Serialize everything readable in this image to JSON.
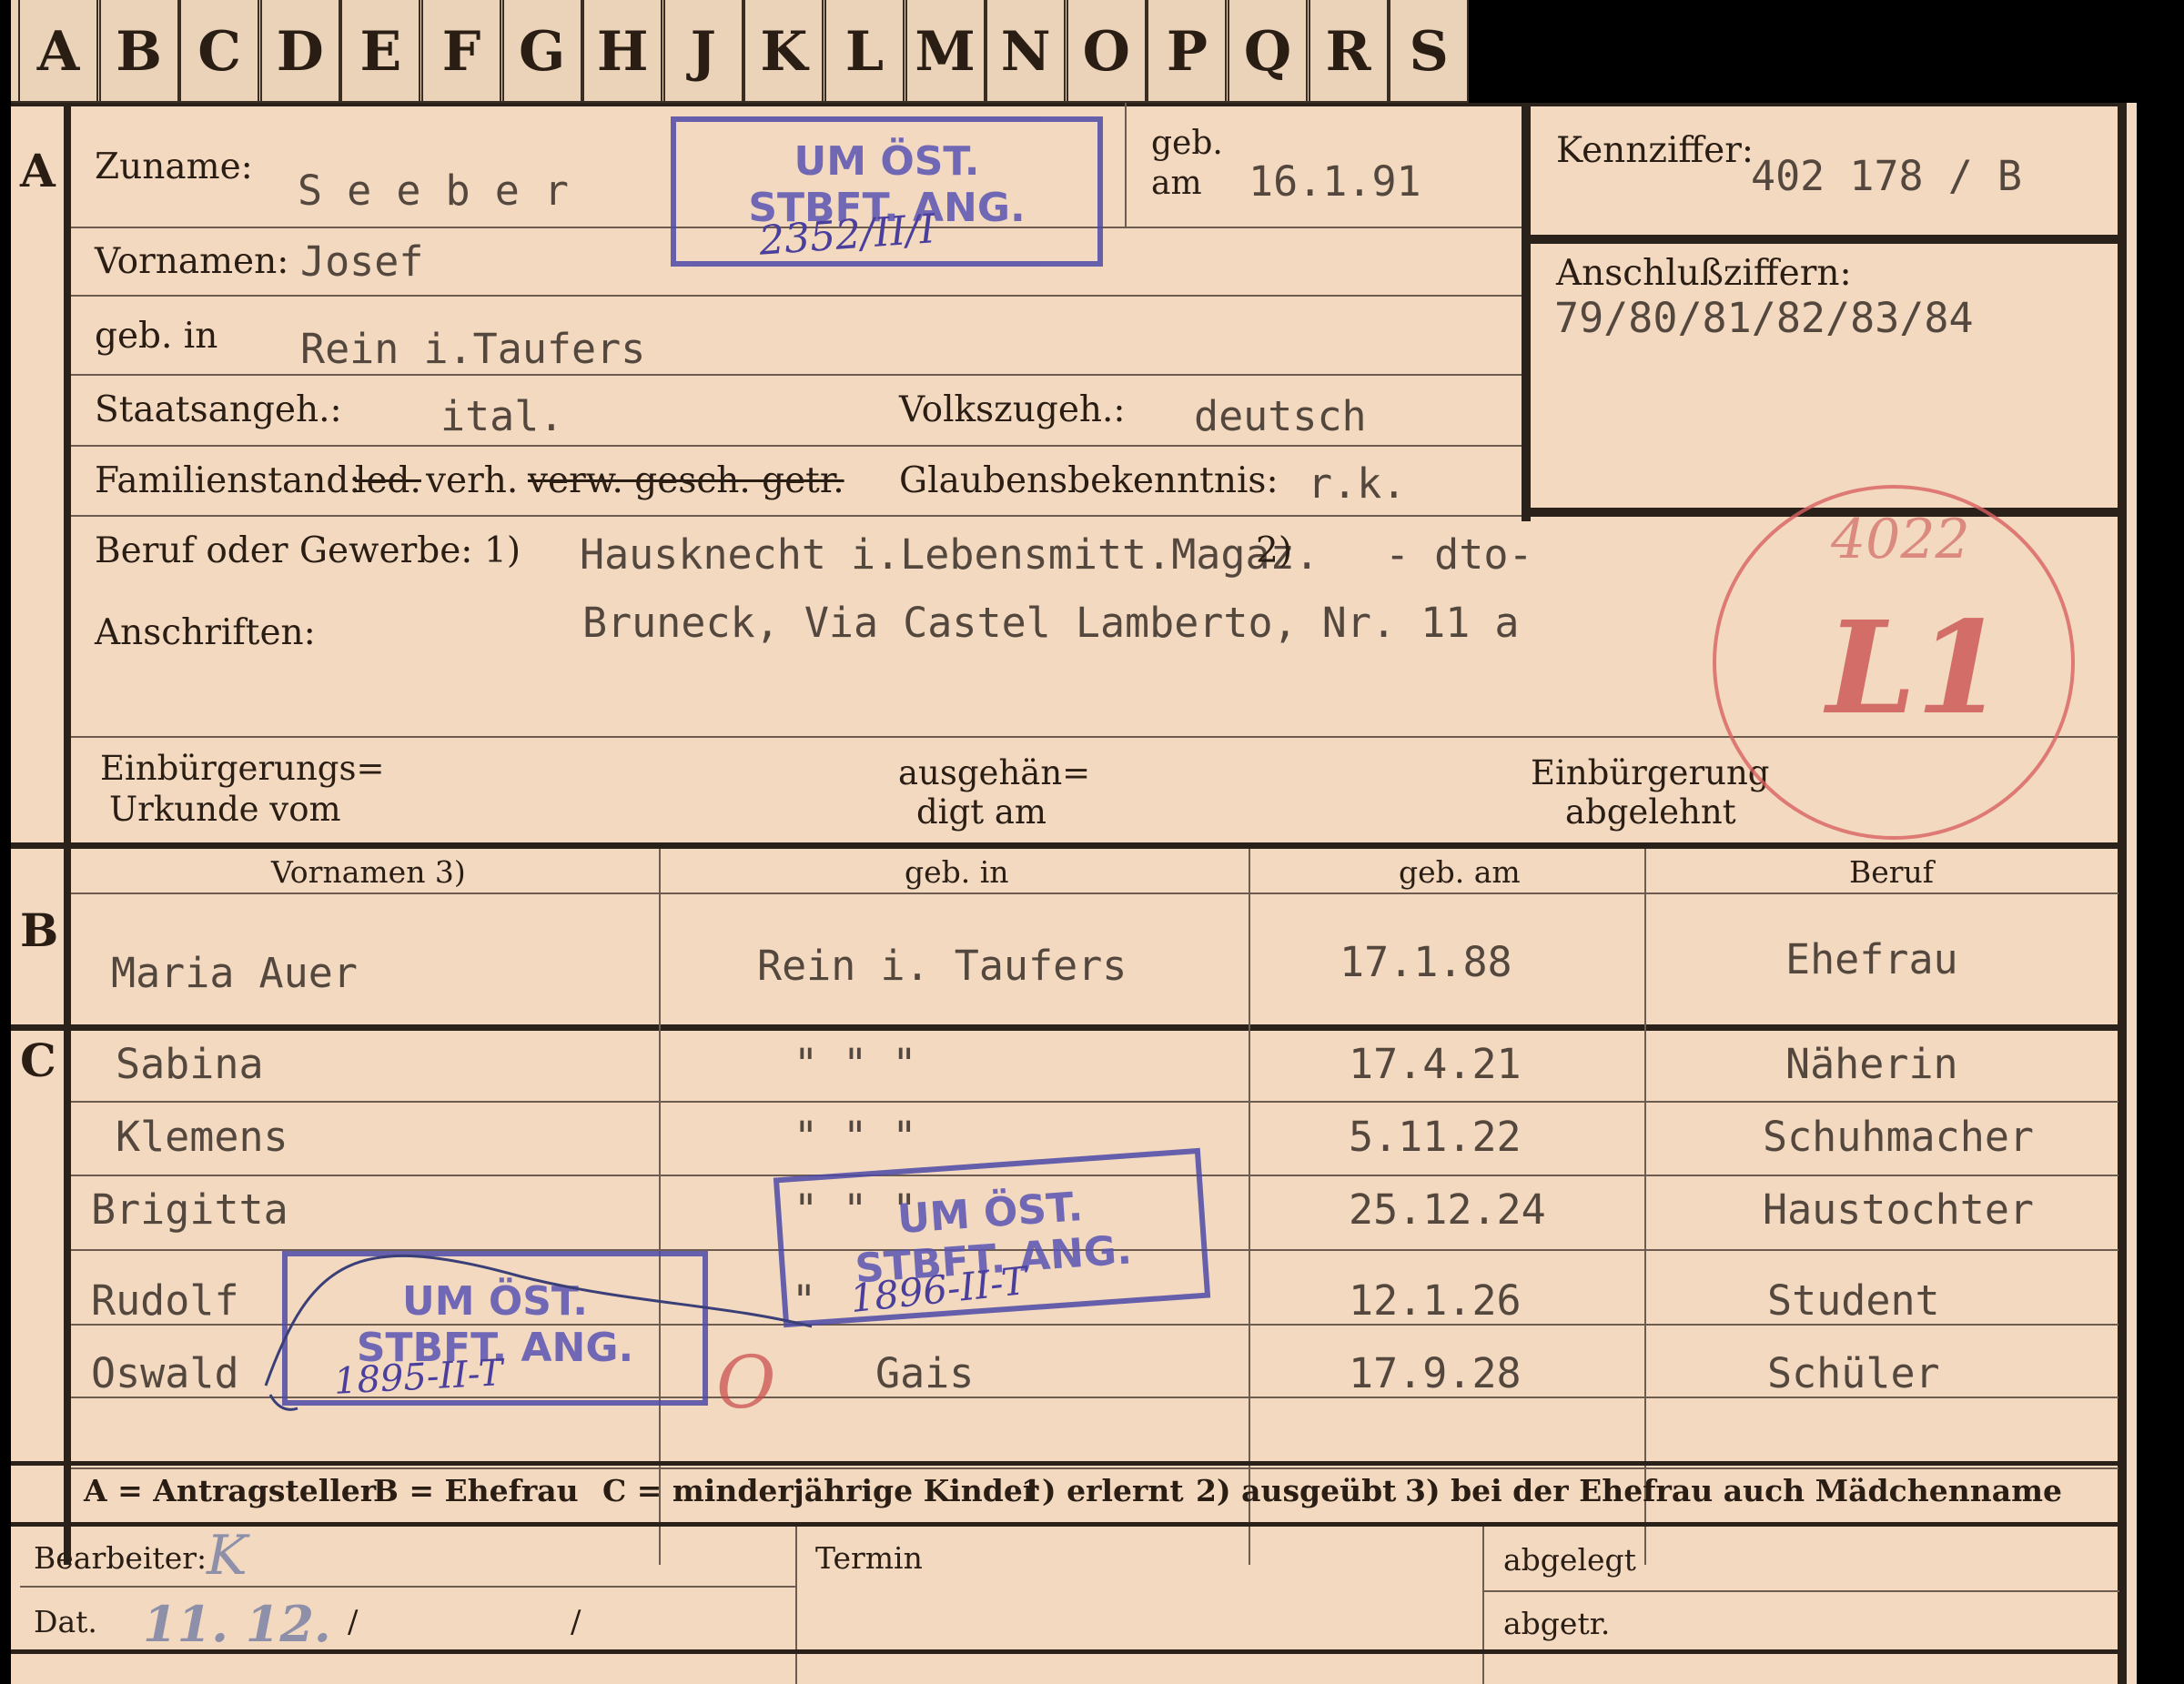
{
  "tabs": [
    "A",
    "B",
    "C",
    "D",
    "E",
    "F",
    "G",
    "H",
    "J",
    "K",
    "L",
    "M",
    "N",
    "O",
    "P",
    "Q",
    "R",
    "S"
  ],
  "sections": {
    "a": "A",
    "b": "B",
    "c": "C"
  },
  "applicant": {
    "surname_label": "Zuname:",
    "surname": "S e e b e r",
    "born_label_1": "geb.",
    "born_label_2": "am",
    "born_date": "16.1.91",
    "first_names_label": "Vornamen:",
    "first_names": "Josef",
    "birthplace_label": "geb. in",
    "birthplace": "Rein i.Taufers",
    "citizenship_label": "Staatsangeh.:",
    "citizenship": "ital.",
    "ethnicity_label": "Volkszugeh.:",
    "ethnicity": "deutsch",
    "marital_label": "Familienstand:",
    "marital_led": "led.",
    "marital_verh": "verh.",
    "marital_struck": "verw. gesch. getr.",
    "religion_label": "Glaubensbekenntnis:",
    "religion": "r.k.",
    "occupation_label": "Beruf oder Gewerbe:",
    "occupation_sup1": "1)",
    "occupation": "Hausknecht i.Lebensmitt.Magaz.",
    "occupation_sup2": "2)",
    "occupation_2": "- dto-",
    "address_label": "Anschriften:",
    "address": "Bruneck, Via Castel Lamberto, Nr. 11 a",
    "naturalization_label_1": "Einbürgerungs=",
    "naturalization_label_2": "Urkunde vom",
    "handed_label_1": "ausgehän=",
    "handed_label_2": "digt am",
    "rejected_label_1": "Einbürgerung",
    "rejected_label_2": "abgelehnt"
  },
  "reference": {
    "number_label": "Kennziffer:",
    "number": "402 178 / B",
    "connection_label": "Anschlußziffern:",
    "connection_numbers": "79/80/81/82/83/84"
  },
  "table": {
    "headers": [
      "Vornamen 3)",
      "geb. in",
      "geb. am",
      "Beruf"
    ],
    "spouse": {
      "name": "Maria   Auer",
      "birthplace": "Rein i. Taufers",
      "birth_date": "17.1.88",
      "occupation": "Ehefrau"
    },
    "children": [
      {
        "name": "Sabina",
        "birthplace": "\"    \"    \"",
        "birth_date": "17.4.21",
        "occupation": "Näherin"
      },
      {
        "name": "Klemens",
        "birthplace": "\"    \"    \"",
        "birth_date": "5.11.22",
        "occupation": "Schuhmacher"
      },
      {
        "name": "Brigitta",
        "birthplace": "\"    \"    \"",
        "birth_date": "25.12.24",
        "occupation": "Haustochter"
      },
      {
        "name": "Rudolf",
        "birthplace": "\"",
        "birth_date": "12.1.26",
        "occupation": "Student"
      },
      {
        "name": "Oswald",
        "birthplace": "Gais",
        "birth_date": "17.9.28",
        "occupation": "Schüler"
      }
    ]
  },
  "stamps": {
    "top": {
      "line1": "UM ÖST.",
      "line2": "STBFT. ANG.",
      "handwritten": "2352/II/I"
    },
    "middle": {
      "line1": "UM ÖST.",
      "line2": "STBFT. ANG.",
      "handwritten": "1896-II-T"
    },
    "bottom": {
      "line1": "UM ÖST.",
      "line2": "STBFT. ANG.",
      "handwritten": "1895-II-T"
    },
    "red_circle_number": "4022",
    "red_circle_mark": "L1",
    "red_mark_small": "O"
  },
  "legend": {
    "a": "A = Antragsteller",
    "b": "B = Ehefrau",
    "c": "C = minderjährige Kinder",
    "n1": "1) erlernt",
    "n2": "2) ausgeübt",
    "n3": "3) bei der Ehefrau auch Mädchenname"
  },
  "footer": {
    "processor_label": "Bearbeiter:",
    "processor_initial": "K",
    "date_label": "Dat.",
    "date_value": "11. 12.",
    "date_slash_1": "/",
    "date_slash_2": "/",
    "deadline_label": "Termin",
    "filed_label": "abgelegt",
    "removed_label": "abgetr."
  },
  "colors": {
    "card": "#f2d9c0",
    "tab": "#ead3b9",
    "stamp": "#4d49a8",
    "red_stamp": "#d86060",
    "ink": "#2a1d14",
    "typewriter": "#54483e"
  }
}
